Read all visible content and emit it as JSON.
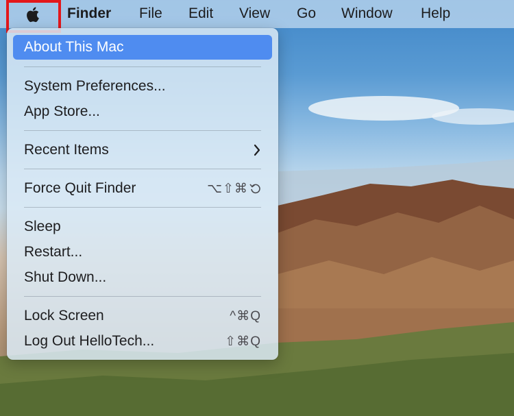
{
  "menubar": {
    "apple_icon": "apple-logo-icon",
    "app_name": "Finder",
    "menus": [
      "File",
      "Edit",
      "View",
      "Go",
      "Window",
      "Help"
    ]
  },
  "apple_menu": {
    "items": [
      {
        "label": "About This Mac",
        "selected": true
      },
      {
        "label": "System Preferences..."
      },
      {
        "label": "App Store..."
      },
      {
        "label": "Recent Items",
        "submenu_icon": "chevron-right-icon"
      },
      {
        "label": "Force Quit Finder",
        "shortcut": "⌥⇧⌘"
      },
      {
        "label": "Sleep"
      },
      {
        "label": "Restart..."
      },
      {
        "label": "Shut Down..."
      },
      {
        "label": "Lock Screen",
        "shortcut": "^⌘Q"
      },
      {
        "label": "Log Out HelloTech...",
        "shortcut": "⇧⌘Q"
      }
    ]
  },
  "colors": {
    "highlight": "#4f8cf0",
    "apple_menu_outline": "#e3171b"
  }
}
